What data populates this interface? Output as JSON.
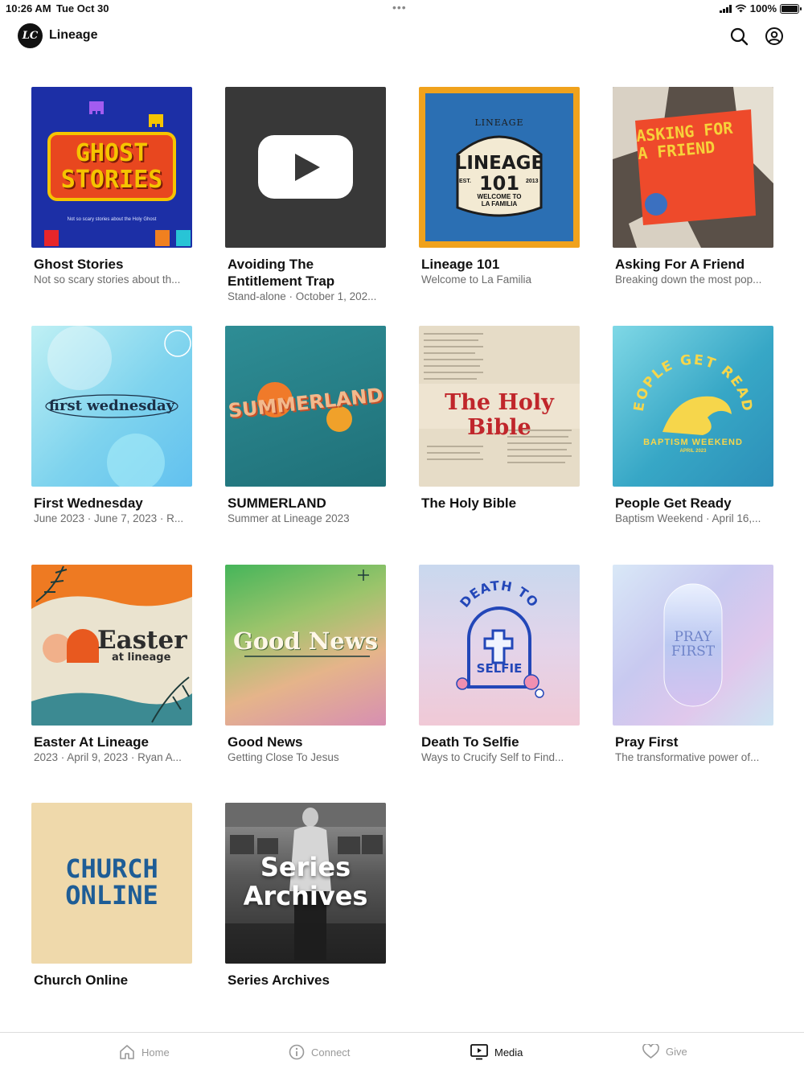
{
  "status_bar": {
    "time": "10:26 AM",
    "date": "Tue Oct 30",
    "battery": "100%"
  },
  "header": {
    "logo_text": "LC",
    "app_title": "Lineage",
    "icons": [
      "search-icon",
      "account-icon"
    ]
  },
  "thumbnails": {
    "ghost_stories": {
      "line1": "GHOST",
      "line2": "STORIES",
      "tagline": "Not so scary stories about the Holy Ghost"
    },
    "lineage_101": {
      "top": "LINEAGE",
      "main": "LINEAGE",
      "number": "101",
      "est": "EST.",
      "year": "2013",
      "welcome": "WELCOME TO LA FAMILIA"
    },
    "asking_friend": {
      "line1": "ASKING FOR",
      "line2": "A FRIEND"
    },
    "first_wednesday": {
      "text": "first wednesday"
    },
    "summerland": {
      "text": "SUMMERLAND"
    },
    "holy_bible": {
      "text": "The Holy Bible"
    },
    "people_ready": {
      "arc": "PEOPLE GET READY",
      "line1": "BAPTISM WEEKEND",
      "line2": "APRIL 2023"
    },
    "easter": {
      "line1": "Easter",
      "line2": "at lineage"
    },
    "good_news": {
      "text": "Good News"
    },
    "death_selfie": {
      "arc": "DEATH TO",
      "label": "SELFIE"
    },
    "pray_first": {
      "line1": "PRAY",
      "line2": "FIRST"
    },
    "church_online": {
      "line1": "CHURCH",
      "line2": "ONLINE"
    },
    "series_archives": {
      "line1": "Series",
      "line2": "Archives"
    }
  },
  "cards": [
    {
      "title": "Ghost Stories",
      "subtitle": "Not so scary stories about th..."
    },
    {
      "title": "Avoiding The Entitlement Trap",
      "subtitle": "Stand-alone · October 1, 202..."
    },
    {
      "title": "Lineage 101",
      "subtitle": "Welcome to La Familia"
    },
    {
      "title": "Asking For A Friend",
      "subtitle": "Breaking down the most pop..."
    },
    {
      "title": "First Wednesday",
      "subtitle": "June 2023 · June 7, 2023 · R..."
    },
    {
      "title": "SUMMERLAND",
      "subtitle": "Summer at Lineage 2023"
    },
    {
      "title": "The Holy Bible",
      "subtitle": ""
    },
    {
      "title": "People Get Ready",
      "subtitle": "Baptism Weekend · April 16,..."
    },
    {
      "title": "Easter At Lineage",
      "subtitle": "2023 · April 9, 2023 · Ryan A..."
    },
    {
      "title": "Good News",
      "subtitle": "Getting Close To Jesus"
    },
    {
      "title": "Death To Selfie",
      "subtitle": "Ways to Crucify Self to Find..."
    },
    {
      "title": "Pray First",
      "subtitle": "The transformative power of..."
    },
    {
      "title": "Church Online",
      "subtitle": ""
    },
    {
      "title": "Series Archives",
      "subtitle": ""
    }
  ],
  "tab_bar": {
    "tabs": [
      {
        "label": "Home",
        "icon": "home-icon",
        "active": false
      },
      {
        "label": "Connect",
        "icon": "info-icon",
        "active": false
      },
      {
        "label": "Media",
        "icon": "media-icon",
        "active": true
      },
      {
        "label": "Give",
        "icon": "heart-icon",
        "active": false
      }
    ]
  }
}
